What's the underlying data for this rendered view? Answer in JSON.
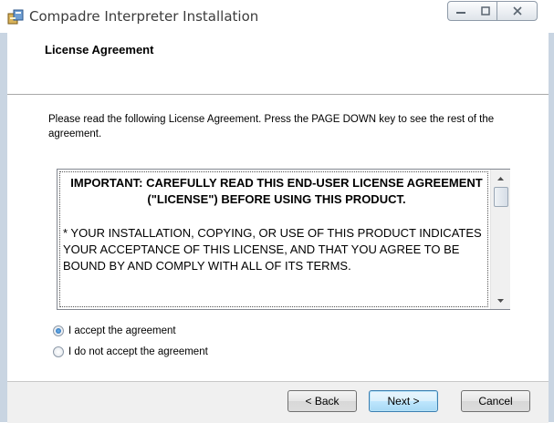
{
  "window": {
    "title": "Compadre Interpreter Installation",
    "icons": {
      "app": "installer-icon",
      "minimize": "minimize-icon",
      "maximize": "maximize-icon",
      "close": "close-icon"
    }
  },
  "header": {
    "title": "License Agreement"
  },
  "body": {
    "instructions": "Please read the following License Agreement. Press the PAGE DOWN key to see the rest of the agreement.",
    "license": {
      "heading_line1": "IMPORTANT:  CAREFULLY READ THIS END-USER LICENSE AGREEMENT",
      "heading_line2": "(\"LICENSE\") BEFORE USING THIS PRODUCT.",
      "paragraph": "* YOUR INSTALLATION, COPYING, OR USE OF THIS PRODUCT INDICATES YOUR ACCEPTANCE OF THIS LICENSE, AND THAT YOU AGREE TO BE BOUND BY AND COMPLY WITH ALL OF ITS TERMS."
    },
    "options": {
      "accept": {
        "label": "I accept the agreement",
        "selected": true
      },
      "decline": {
        "label": "I do not accept the agreement",
        "selected": false
      }
    }
  },
  "footer": {
    "back_label": "< Back",
    "next_label": "Next >",
    "cancel_label": "Cancel"
  },
  "colors": {
    "frame": "#c9d5e2",
    "footer_bg": "#f0f0f0",
    "default_button_border": "#3c7fb1"
  }
}
